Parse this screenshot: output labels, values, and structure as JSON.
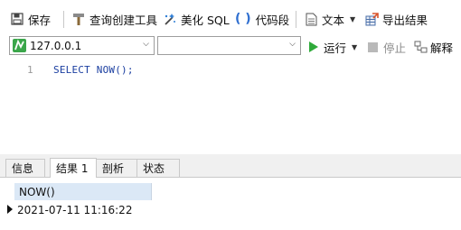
{
  "toolbar": {
    "save": "保存",
    "query_builder": "查询创建工具",
    "beautify_sql": "美化 SQL",
    "code_snippet": "代码段",
    "text": "文本",
    "export_results": "导出结果"
  },
  "connection_bar": {
    "connection_value": "127.0.0.1",
    "database_value": "",
    "run": "运行",
    "stop": "停止",
    "explain": "解释"
  },
  "editor": {
    "line_number": "1",
    "code": "SELECT NOW();"
  },
  "results": {
    "tabs": [
      "信息",
      "结果 1",
      "剖析",
      "状态"
    ],
    "active_tab": "结果 1",
    "column_header": "NOW()",
    "rows": [
      [
        "2021-07-11 11:16:22"
      ]
    ]
  },
  "colors": {
    "accent_green": "#3aa64a",
    "header_blue": "#dbe8f6",
    "code_blue": "#1a3ea0"
  }
}
